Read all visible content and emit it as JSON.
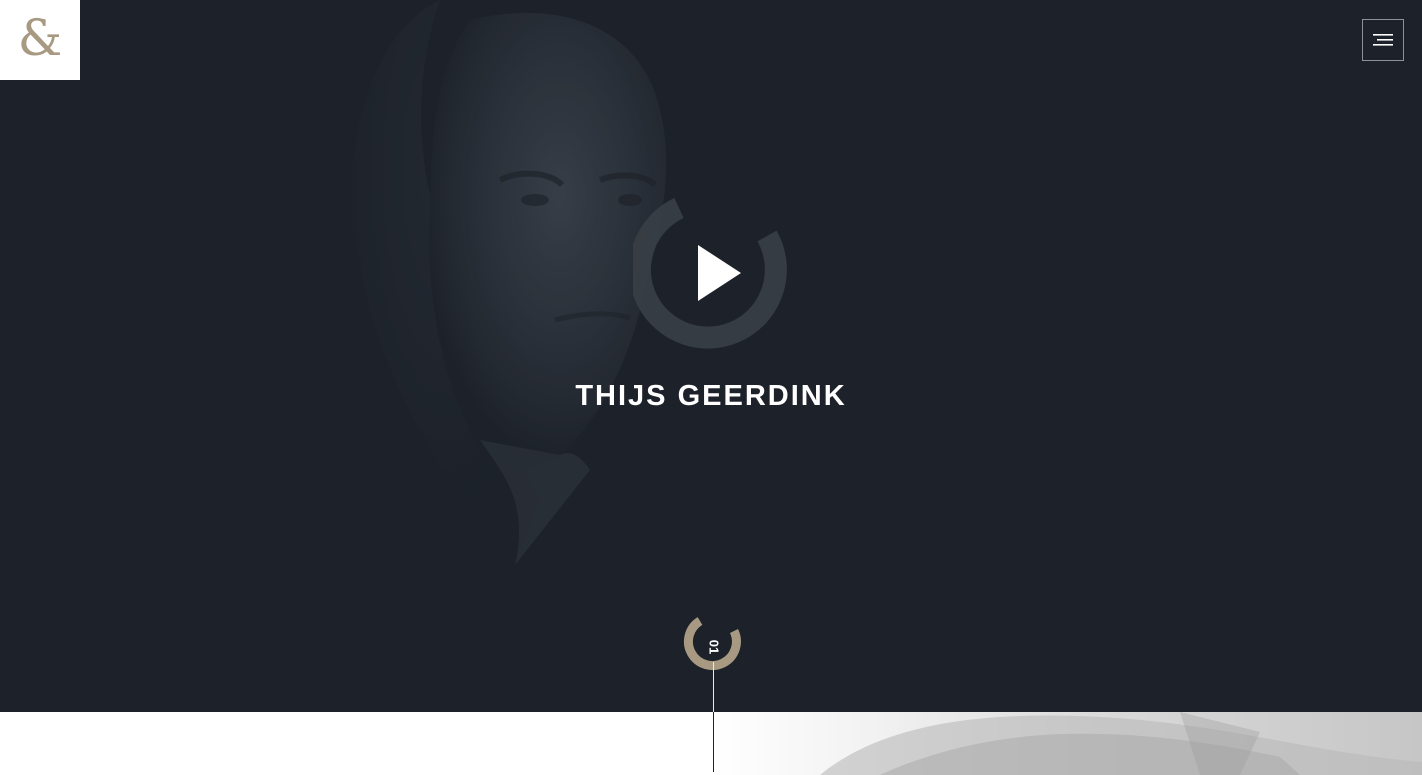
{
  "brand": {
    "logo_glyph": "&",
    "logo_color": "#a89a82"
  },
  "header": {
    "menu_icon": "hamburger-icon"
  },
  "hero": {
    "title": "THIJS GEERDINK",
    "play_icon": "play-icon",
    "background_color": "#1d222a"
  },
  "scroll": {
    "badge_label": "01",
    "accent_color": "#a89a82"
  }
}
